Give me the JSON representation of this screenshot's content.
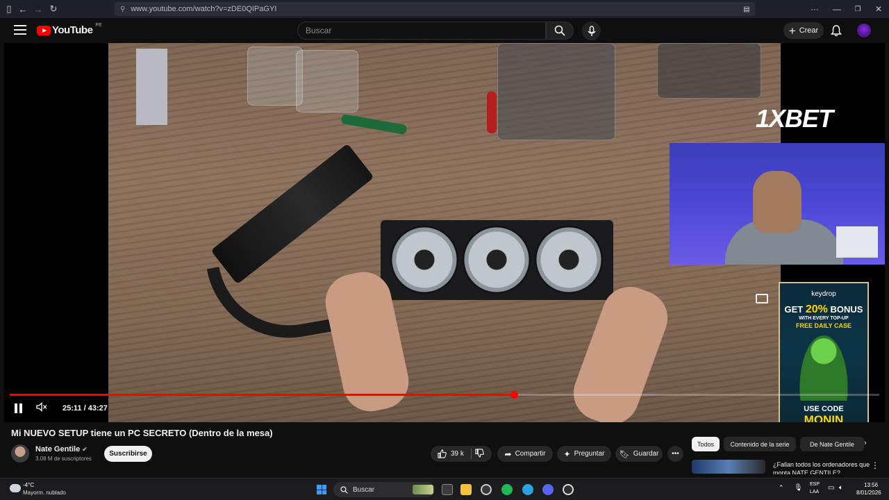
{
  "browser": {
    "url": "www.youtube.com/watch?v=zDE0QIPaGYI"
  },
  "header": {
    "logo_text": "YouTube",
    "country_code": "PE",
    "search_placeholder": "Buscar",
    "create_label": "Crear"
  },
  "video": {
    "overlay_brand": "1XBET",
    "progress_fraction": 0.58,
    "current_time": "25:11",
    "separator": "/",
    "duration": "43:27",
    "ad": {
      "brand": "keydrop",
      "bonus_prefix": "GET",
      "bonus_value": "20%",
      "bonus_suffix": "BONUS",
      "bonus_note": "WITH EVERY TOP-UP",
      "free_case": "FREE DAILY CASE",
      "use_code": "USE CODE",
      "code": "MONIN"
    }
  },
  "details": {
    "title": "Mi NUEVO SETUP tiene un PC SECRETO (Dentro de la mesa)",
    "channel_name": "Nate Gentile",
    "subscribers": "3.08 M de suscriptores",
    "subscribe_label": "Suscribirse",
    "likes": "39 k",
    "share_label": "Compartir",
    "ask_label": "Preguntar",
    "save_label": "Guardar"
  },
  "sidebar": {
    "chips": [
      "Todos",
      "Contenido de la serie",
      "De Nate Gentile"
    ],
    "recommended_title": "¿Fallan todos los ordenadores que monta NATE GENTILE?..."
  },
  "taskbar": {
    "temperature": "-4°C",
    "weather": "Mayorm. nublado",
    "search_label": "Buscar",
    "lang_top": "ESP",
    "lang_bottom": "LAA",
    "time": "13:56",
    "date": "8/01/2026"
  },
  "colors": {
    "accent": "#ff0000",
    "background": "#0f0f0f",
    "ad_code": "#ffd400"
  }
}
